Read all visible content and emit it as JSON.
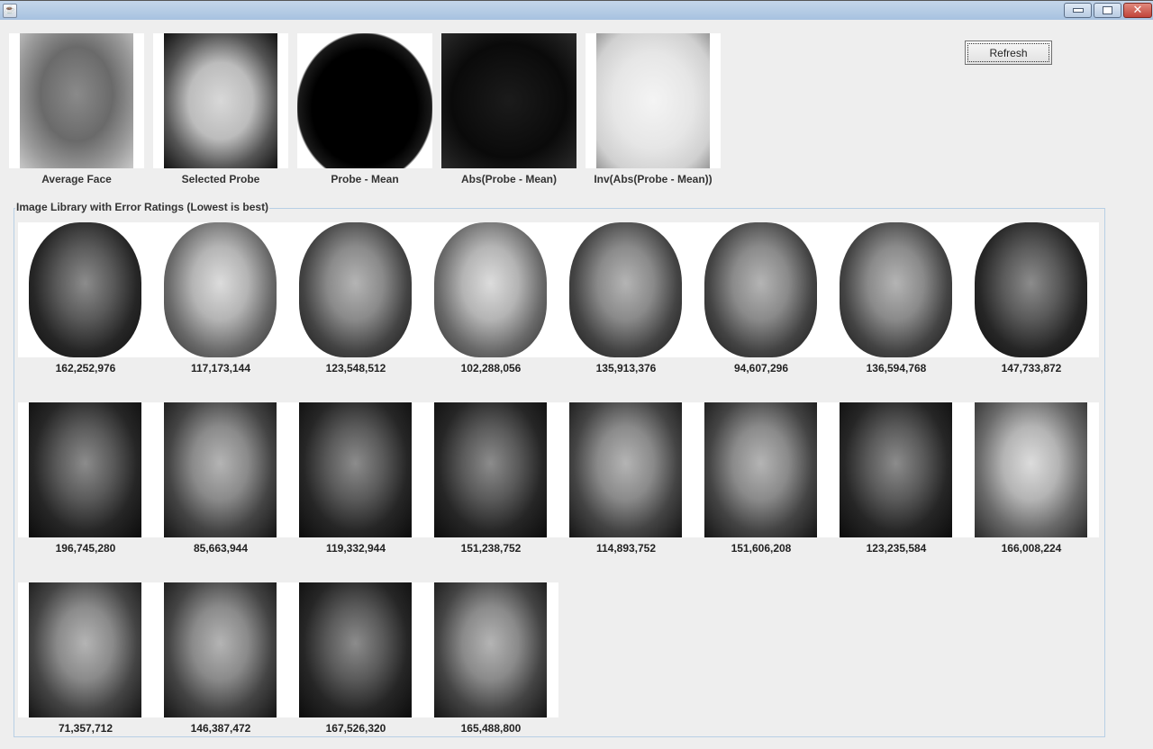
{
  "window": {
    "app_icon": "java-icon",
    "controls": {
      "minimize": "minimize-icon",
      "maximize": "restore-icon",
      "close": "close-icon"
    }
  },
  "analysis_panels": [
    {
      "label": "Average Face",
      "type": "average-face"
    },
    {
      "label": "Selected Probe",
      "type": "probe"
    },
    {
      "label": "Probe - Mean",
      "type": "probe-minus-mean"
    },
    {
      "label": "Abs(Probe - Mean)",
      "type": "abs-diff"
    },
    {
      "label": "Inv(Abs(Probe - Mean))",
      "type": "inv-abs-diff"
    }
  ],
  "refresh_button": {
    "label": "Refresh"
  },
  "library": {
    "title": "Image Library with Error Ratings (Lowest is best)",
    "items": [
      {
        "score": "162,252,976",
        "tone": "dark"
      },
      {
        "score": "117,173,144",
        "tone": "light"
      },
      {
        "score": "123,548,512",
        "tone": "mid"
      },
      {
        "score": "102,288,056",
        "tone": "light"
      },
      {
        "score": "135,913,376",
        "tone": "mid"
      },
      {
        "score": "94,607,296",
        "tone": "mid"
      },
      {
        "score": "136,594,768",
        "tone": "mid"
      },
      {
        "score": "147,733,872",
        "tone": "dark"
      },
      {
        "score": "196,745,280",
        "tone": "dark"
      },
      {
        "score": "85,663,944",
        "tone": "mid"
      },
      {
        "score": "119,332,944",
        "tone": "dark"
      },
      {
        "score": "151,238,752",
        "tone": "dark"
      },
      {
        "score": "114,893,752",
        "tone": "mid"
      },
      {
        "score": "151,606,208",
        "tone": "mid"
      },
      {
        "score": "123,235,584",
        "tone": "dark"
      },
      {
        "score": "166,008,224",
        "tone": "light"
      },
      {
        "score": "71,357,712",
        "tone": "mid"
      },
      {
        "score": "146,387,472",
        "tone": "mid"
      },
      {
        "score": "167,526,320",
        "tone": "dark"
      },
      {
        "score": "165,488,800",
        "tone": "mid"
      }
    ]
  }
}
